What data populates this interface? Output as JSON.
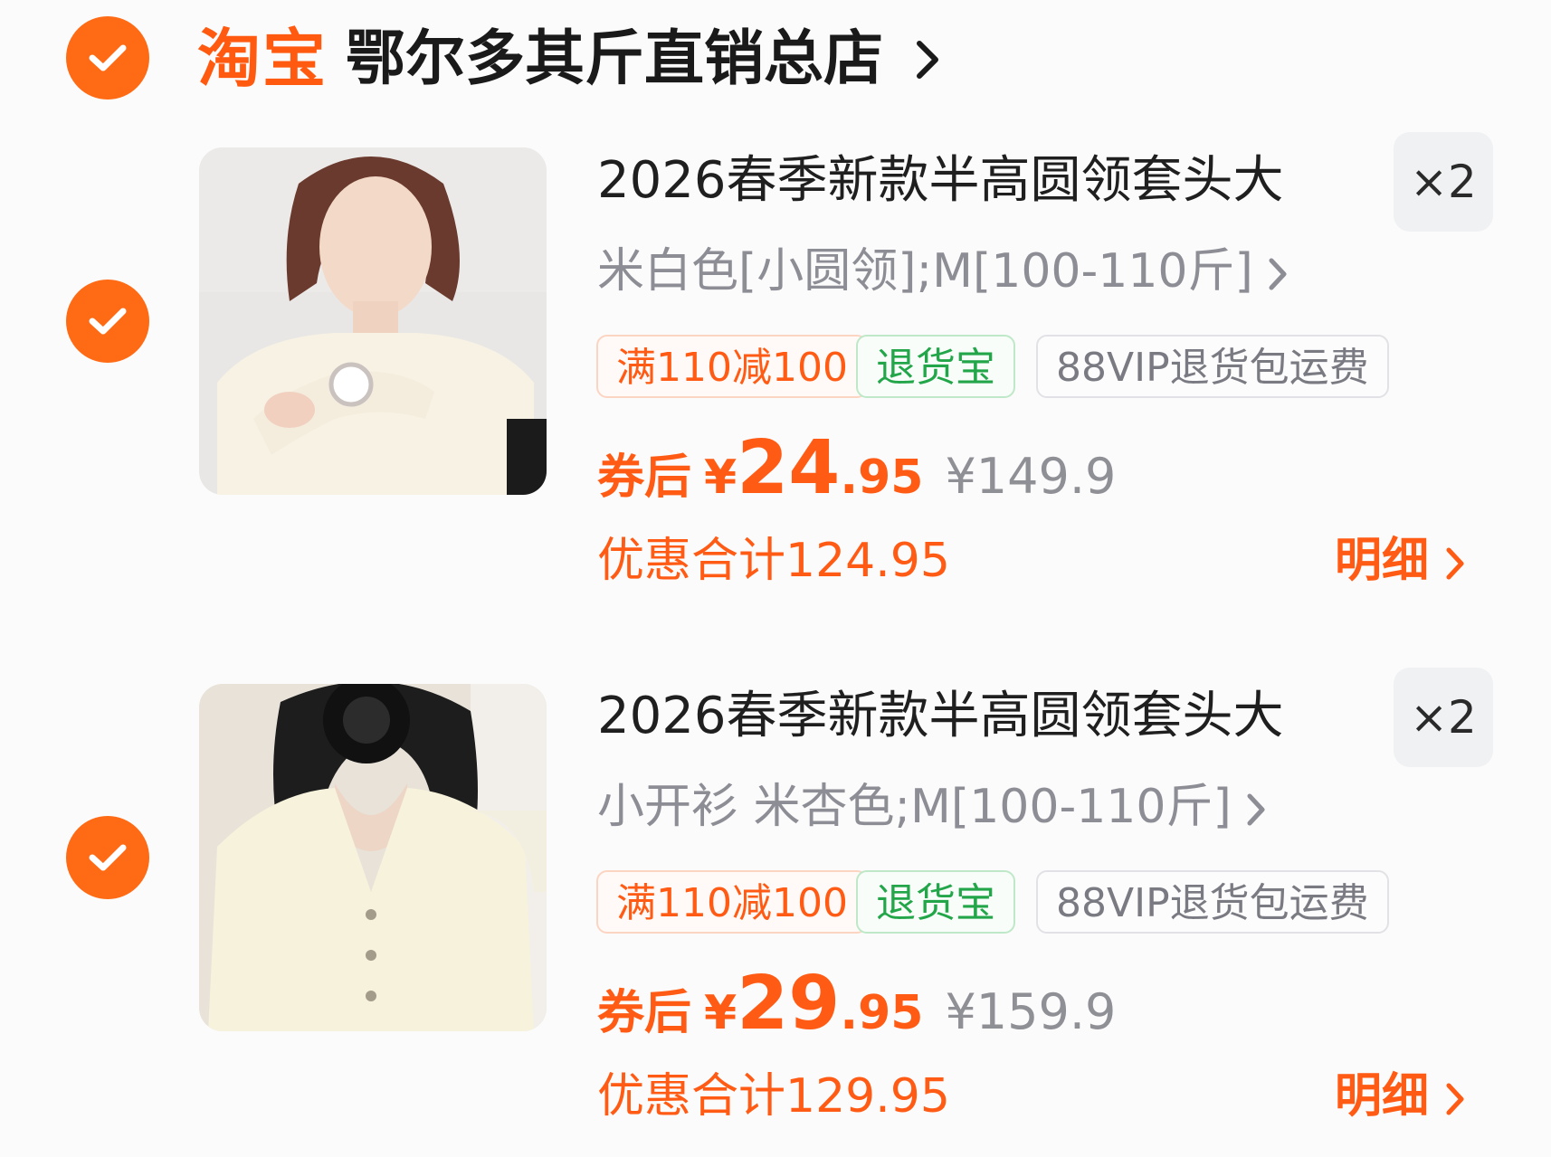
{
  "colors": {
    "accent": "#ff6a14",
    "coupon_text": "#ff5b14",
    "return_text": "#23a64a",
    "muted_text": "#8d8d95"
  },
  "shop": {
    "logo_text": "淘宝",
    "name": "鄂尔多其斤直销总店",
    "checked": true,
    "check_icon": "check-icon",
    "chevron_icon": "chevron-right-icon"
  },
  "items": [
    {
      "checked": true,
      "image_desc": "woman in cream round-neck sweater",
      "title": "2026春季新款半高圆领套头大",
      "quantity": "×2",
      "sku": "米白色[小圆领];M[100-110斤]",
      "tags": {
        "coupon": "满110减100",
        "return": "退货宝",
        "vip": "88VIP退货包运费"
      },
      "price_prefix": "券后",
      "price_symbol": "¥",
      "price_int": "24",
      "price_dec": ".95",
      "original_price": "¥149.9",
      "saving_text": "优惠合计124.95",
      "detail_label": "明细"
    },
    {
      "checked": true,
      "image_desc": "woman in cream v-neck cardigan",
      "title": "2026春季新款半高圆领套头大",
      "quantity": "×2",
      "sku": "小开衫 米杏色;M[100-110斤]",
      "tags": {
        "coupon": "满110减100",
        "return": "退货宝",
        "vip": "88VIP退货包运费"
      },
      "price_prefix": "券后",
      "price_symbol": "¥",
      "price_int": "29",
      "price_dec": ".95",
      "original_price": "¥159.9",
      "saving_text": "优惠合计129.95",
      "detail_label": "明细"
    }
  ]
}
